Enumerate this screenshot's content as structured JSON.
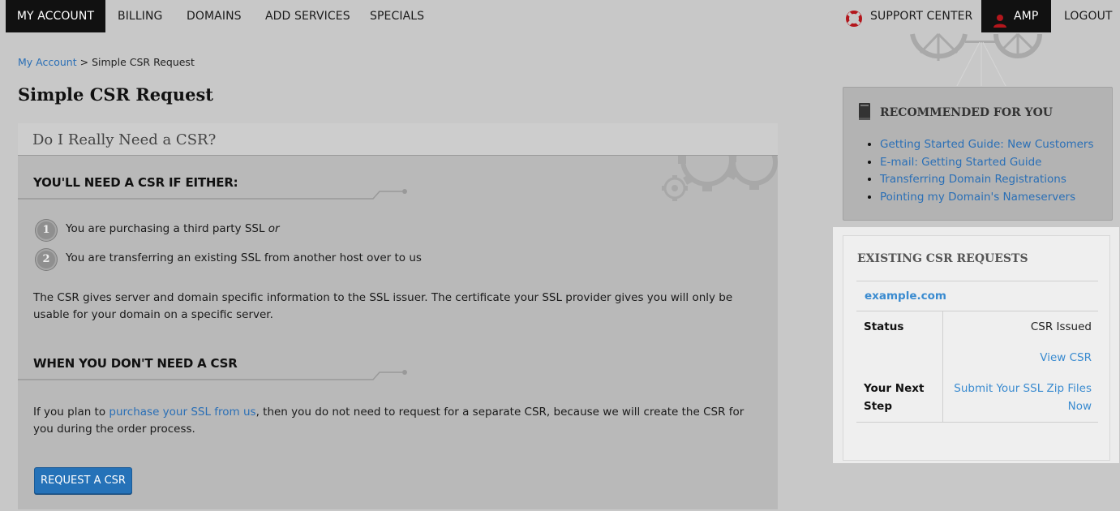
{
  "nav": {
    "left": [
      "MY ACCOUNT",
      "BILLING",
      "DOMAINS",
      "ADD SERVICES",
      "SPECIALS"
    ],
    "support": "SUPPORT CENTER",
    "user": "AMP",
    "logout": "LOGOUT"
  },
  "breadcrumb": {
    "home": "My Account",
    "separator": ">",
    "current": "Simple CSR Request"
  },
  "page_title": "Simple CSR Request",
  "main": {
    "card_title": "Do I Really Need a CSR?",
    "section1_title": "YOU'LL NEED A CSR IF EITHER:",
    "items": [
      {
        "num": "1",
        "text": "You are purchasing a third party SSL",
        "suffix": "or"
      },
      {
        "num": "2",
        "text": "You are transferring an existing SSL from another host over to us"
      }
    ],
    "paragraph1": "The CSR gives server and domain specific information to the SSL issuer. The certificate your SSL provider gives you will only be usable for your domain on a specific server.",
    "section2_title": "WHEN YOU DON'T NEED A CSR",
    "para2_before": "If you plan to ",
    "para2_link": "purchase your SSL from us",
    "para2_after": ", then you do not need to request for a separate CSR, because we will create the CSR for you during the order process.",
    "button": "REQUEST A CSR"
  },
  "sidebar": {
    "rec_title": "RECOMMENDED FOR YOU",
    "rec_links": [
      "Getting Started Guide: New Customers",
      "E-mail: Getting Started Guide",
      "Transferring Domain Registrations",
      "Pointing my Domain's Nameservers"
    ],
    "csr_title": "EXISTING CSR REQUESTS",
    "csr_domain": "example.com",
    "status_label": "Status",
    "status_value": "CSR Issued",
    "view_csr": "View CSR",
    "next_label": "Your Next Step",
    "next_value": "Submit Your SSL Zip Files Now"
  },
  "colors": {
    "accent": "#2572b8",
    "link": "#2a6fb6",
    "nav_active": "#111111",
    "support_icon": "#b3161c"
  },
  "icons": [
    "lifebuoy-icon",
    "user-icon",
    "book-icon",
    "gear-decoration"
  ]
}
